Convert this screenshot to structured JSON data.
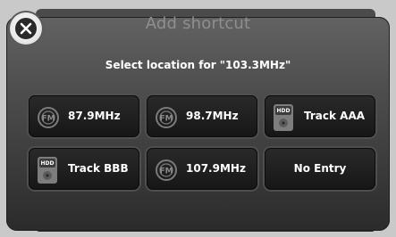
{
  "dialog": {
    "title": "Add shortcut",
    "subtitle": "Select location for \"103.3MHz\""
  },
  "tiles": [
    {
      "label": "87.9MHz",
      "icon": "fm-radio-icon"
    },
    {
      "label": "98.7MHz",
      "icon": "fm-radio-icon"
    },
    {
      "label": "Track AAA",
      "icon": "hdd-icon"
    },
    {
      "label": "Track BBB",
      "icon": "hdd-icon"
    },
    {
      "label": "107.9MHz",
      "icon": "fm-radio-icon"
    },
    {
      "label": "No Entry",
      "icon": ""
    }
  ],
  "icons": {
    "close": "close-icon",
    "fm_badge_text": "FM",
    "hdd_badge_text": "HDD"
  },
  "colors": {
    "tile_border": "#4f4f4f",
    "tile_fill": "#1b1b1b",
    "title_text": "#8f8f8f",
    "label_text": "#ffffff"
  }
}
